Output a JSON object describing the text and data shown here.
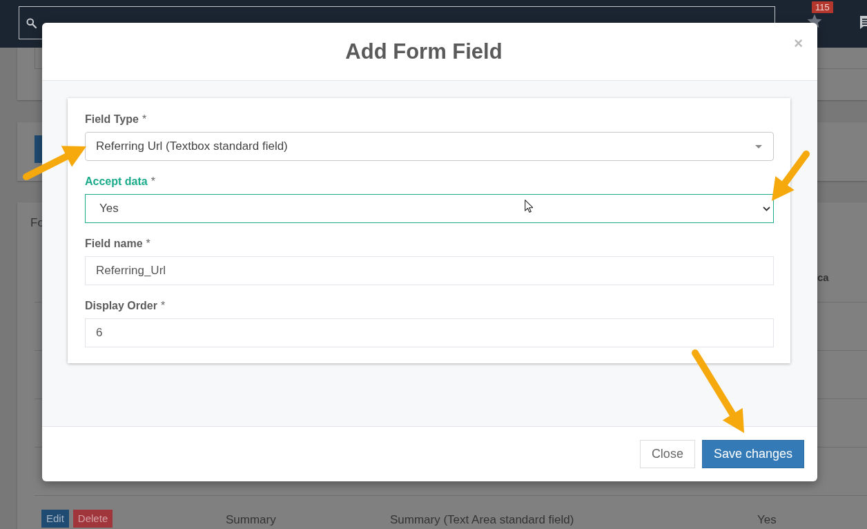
{
  "navbar": {
    "notification_count": "115"
  },
  "page": {
    "section_title": "Fo",
    "table": {
      "columns": [
        "ca"
      ],
      "rows": [
        {
          "actions": [
            {
              "label": "Edit",
              "kind": "primary"
            },
            {
              "label": "Delete",
              "kind": "danger"
            }
          ],
          "cells": [
            "Summary",
            "Summary (Text Area standard field)",
            "Yes"
          ]
        }
      ]
    }
  },
  "modal": {
    "title": "Add Form Field",
    "close_label": "×",
    "fields": [
      {
        "kind": "select2",
        "label": "Field Type",
        "required_mark": "*",
        "value": "Referring Url (Textbox standard field)",
        "focused": false
      },
      {
        "kind": "select",
        "label": "Accept data",
        "required_mark": "*",
        "value": "Yes",
        "focused": true
      },
      {
        "kind": "text",
        "label": "Field name",
        "required_mark": "*",
        "value": "Referring_Url",
        "focused": false
      },
      {
        "kind": "text",
        "label": "Display Order",
        "required_mark": "*",
        "value": "6",
        "focused": false
      }
    ],
    "buttons": [
      {
        "label": "Close",
        "kind": "default"
      },
      {
        "label": "Save changes",
        "kind": "primary"
      }
    ]
  }
}
